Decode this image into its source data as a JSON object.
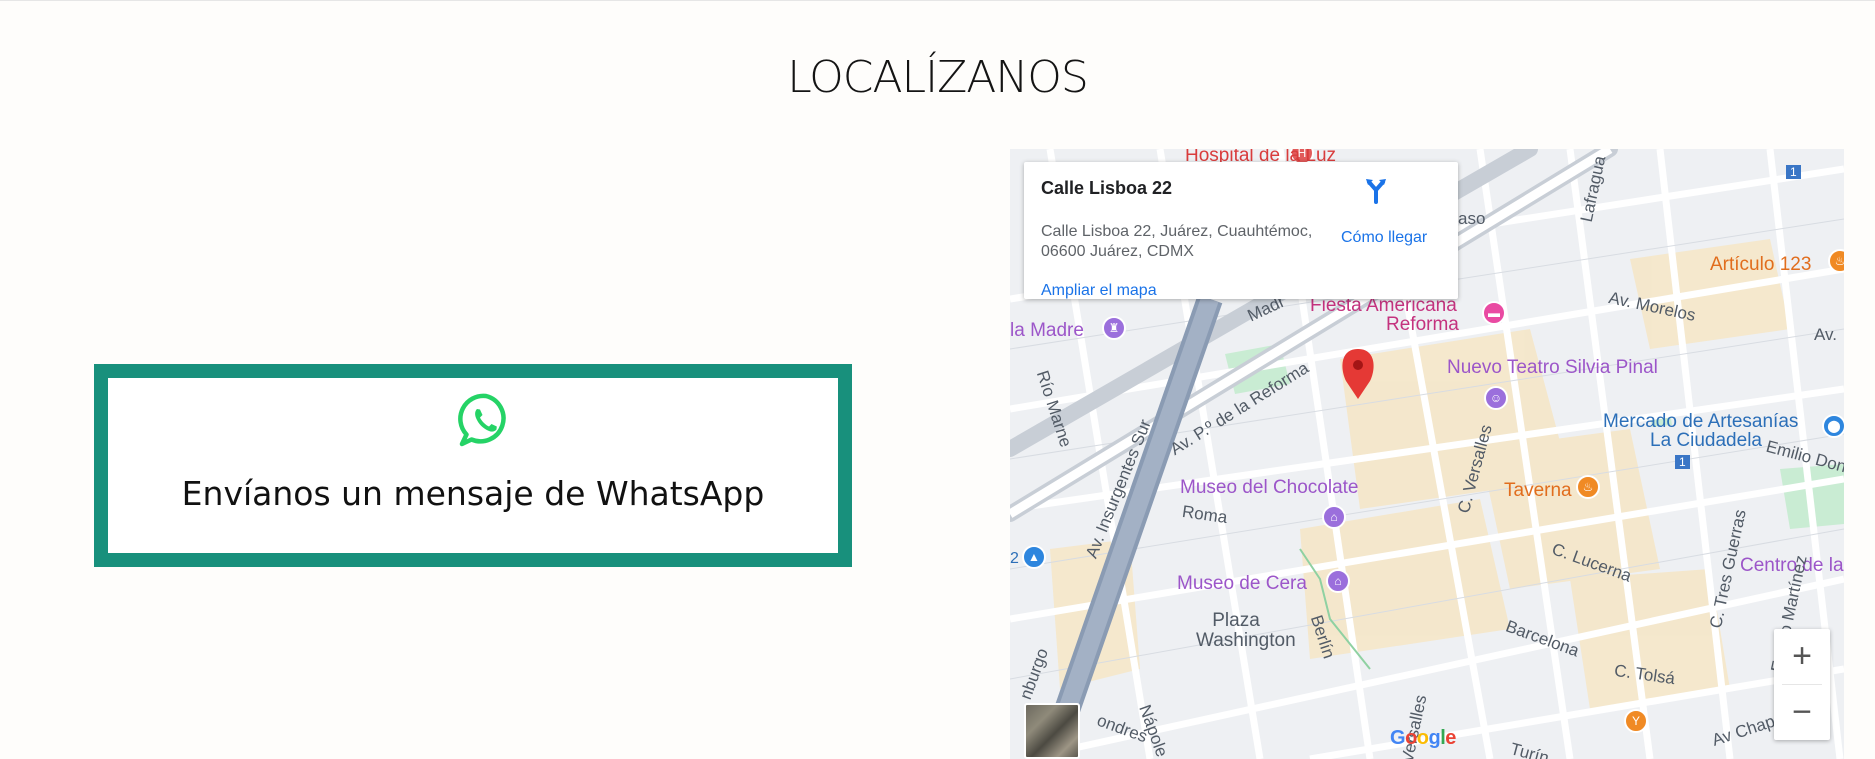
{
  "section": {
    "title": "LOCALÍZANOS"
  },
  "whatsapp": {
    "label": "Envíanos un mensaje de WhatsApp",
    "icon": "whatsapp-icon",
    "color": "#25d366",
    "border_color": "#18907c"
  },
  "map": {
    "info": {
      "title": "Calle Lisboa 22",
      "address_line1": "Calle Lisboa 22, Juárez, Cuauhtémoc,",
      "address_line2": "06600 Juárez, CDMX",
      "directions": "Cómo llegar",
      "enlarge": "Ampliar el mapa"
    },
    "pois": {
      "hospital": "Hospital de la Luz",
      "articulo": "Artículo 123",
      "fiesta1": "Fiesta Americana",
      "fiesta2": "Reforma",
      "madre": "la Madre",
      "teatro": "Nuevo Teatro Silvia Pinal",
      "mercado1": "Mercado de Artesanías",
      "mercado2": "La Ciudadela",
      "chocolate": "Museo del Chocolate",
      "taverna": "Taverna",
      "cera": "Museo de Cera",
      "centro": "Centro de la",
      "plaza1": "Plaza",
      "plaza2": "Washington"
    },
    "streets": {
      "morelos": "Av. Morelos",
      "lafragua": "Lafragua",
      "reforma": "Av. P.º de la Reforma",
      "insurgentes": "Av. Insurgentes Sur",
      "rio_marne": "Río Marne",
      "roma": "Roma",
      "versalles": "C. Versalles",
      "lucerna": "C. Lucerna",
      "barcelona": "Barcelona",
      "tolsa": "C. Tolsá",
      "berlin": "Berlín",
      "tres_guerras": "C. Tres Guerras",
      "enrico": "Enrico Martínez",
      "chapultepec": "Av Chapultepe",
      "emilio": "Emilio Don",
      "paso": "aso",
      "madr": "Madr",
      "av": "Av.",
      "nburgo": "nburgo",
      "londres": "ondres",
      "napoles": "Nápole",
      "versalles2": "Versalles",
      "turin": "Turín",
      "n1": "1",
      "n2": "1",
      "n3": "2"
    },
    "zoom_in": "+",
    "zoom_out": "−",
    "brand": "Google"
  }
}
